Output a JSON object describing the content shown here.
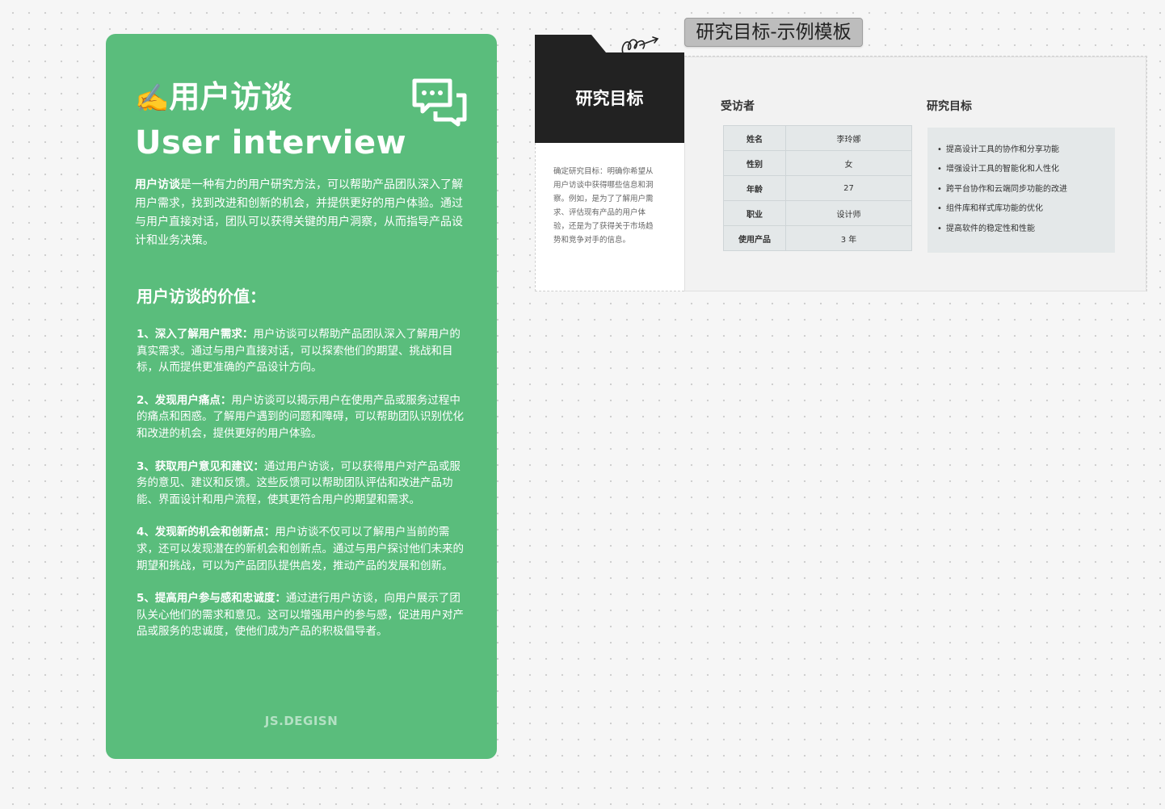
{
  "card": {
    "emoji": "✍️",
    "title": "用户访谈",
    "subtitle": "User interview",
    "intro_bold": "用户访谈",
    "intro_rest": "是一种有力的用户研究方法，可以帮助产品团队深入了解用户需求，找到改进和创新的机会，并提供更好的用户体验。通过与用户直接对话，团队可以获得关键的用户洞察，从而指导产品设计和业务决策。",
    "section_heading": "用户访谈的价值：",
    "values": [
      {
        "bold": "1、深入了解用户需求：",
        "text": "用户访谈可以帮助产品团队深入了解用户的真实需求。通过与用户直接对话，可以探索他们的期望、挑战和目标，从而提供更准确的产品设计方向。"
      },
      {
        "bold": "2、发现用户痛点：",
        "text": "用户访谈可以揭示用户在使用产品或服务过程中的痛点和困惑。了解用户遇到的问题和障碍，可以帮助团队识别优化和改进的机会，提供更好的用户体验。"
      },
      {
        "bold": "3、获取用户意见和建议：",
        "text": "通过用户访谈，可以获得用户对产品或服务的意见、建议和反馈。这些反馈可以帮助团队评估和改进产品功能、界面设计和用户流程，使其更符合用户的期望和需求。"
      },
      {
        "bold": "4、发现新的机会和创新点：",
        "text": "用户访谈不仅可以了解用户当前的需求，还可以发现潜在的新机会和创新点。通过与用户探讨他们未来的期望和挑战，可以为产品团队提供启发，推动产品的发展和创新。"
      },
      {
        "bold": "5、提高用户参与感和忠诚度：",
        "text": "通过进行用户访谈，向用户展示了团队关心他们的需求和意见。这可以增强用户的参与感，促进用户对产品或服务的忠诚度，使他们成为产品的积极倡导者。"
      }
    ],
    "brand": "JS.DEGISN"
  },
  "template": {
    "label": "研究目标-示例模板",
    "dark_title": "研究目标",
    "description": "确定研究目标：明确你希望从用户访谈中获得哪些信息和洞察。例如，是为了了解用户需求、评估现有产品的用户体验，还是为了获得关于市场趋势和竞争对手的信息。",
    "interviewee_title": "受访者",
    "goals_title": "研究目标",
    "rows": [
      {
        "key": "姓名",
        "value": "李玲娜"
      },
      {
        "key": "性别",
        "value": "女"
      },
      {
        "key": "年龄",
        "value": "27"
      },
      {
        "key": "职业",
        "value": "设计师"
      },
      {
        "key": "使用产品",
        "value": "3 年"
      }
    ],
    "goals": [
      "提高设计工具的协作和分享功能",
      "增强设计工具的智能化和人性化",
      "跨平台协作和云端同步功能的改进",
      "组件库和样式库功能的优化",
      "提高软件的稳定性和性能"
    ]
  },
  "colors": {
    "card_green": "#5abd7c",
    "dark_block": "#222222",
    "panel_gray": "#f2f2f2",
    "table_fill": "#e4e8e9"
  },
  "icons": [
    "writing-hand-emoji",
    "chat-bubbles-icon",
    "folder-tab-shape",
    "scribble-doodle"
  ]
}
